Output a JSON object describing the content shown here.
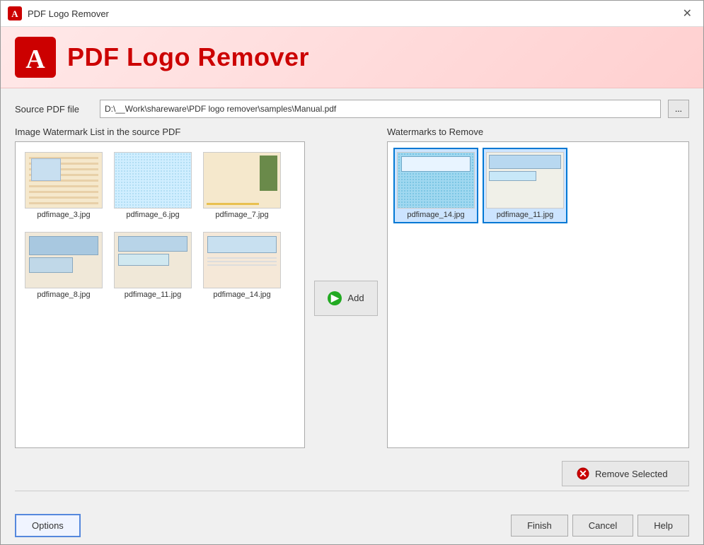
{
  "window": {
    "title": "PDF Logo Remover",
    "close_label": "✕"
  },
  "header": {
    "title": "PDF Logo Remover"
  },
  "source_file": {
    "label": "Source PDF file",
    "value": "D:\\__Work\\shareware\\PDF logo remover\\samples\\Manual.pdf",
    "browse_label": "..."
  },
  "left_panel": {
    "label": "Image Watermark List in the source PDF",
    "images": [
      {
        "name": "pdfimage_3.jpg",
        "thumb_class": "thumb-3"
      },
      {
        "name": "pdfimage_6.jpg",
        "thumb_class": "thumb-6"
      },
      {
        "name": "pdfimage_7.jpg",
        "thumb_class": "thumb-7"
      },
      {
        "name": "pdfimage_8.jpg",
        "thumb_class": "thumb-8"
      },
      {
        "name": "pdfimage_11.jpg",
        "thumb_class": "thumb-11"
      },
      {
        "name": "pdfimage_14.jpg",
        "thumb_class": "thumb-14"
      }
    ]
  },
  "add_button": {
    "label": "Add"
  },
  "right_panel": {
    "label": "Watermarks to Remove",
    "images": [
      {
        "name": "pdfimage_14.jpg",
        "thumb_class": "thumb-14-sel"
      },
      {
        "name": "pdfimage_11.jpg",
        "thumb_class": "thumb-11-sel"
      }
    ]
  },
  "remove_button": {
    "label": "Remove Selected"
  },
  "bottom": {
    "options_label": "Options",
    "finish_label": "Finish",
    "cancel_label": "Cancel",
    "help_label": "Help"
  }
}
